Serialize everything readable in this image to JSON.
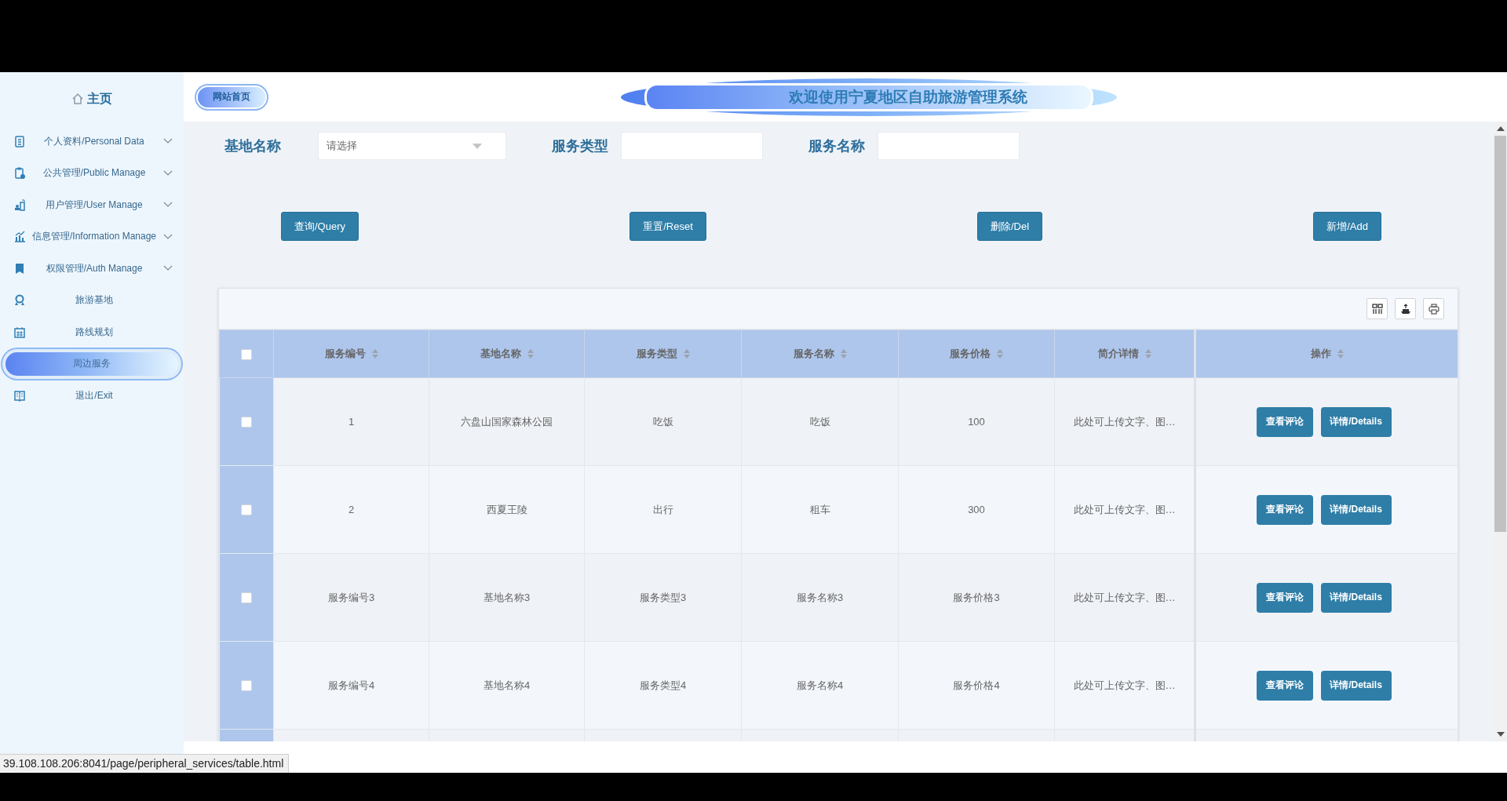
{
  "sidebar": {
    "home": "主页",
    "items": [
      {
        "label": "个人资料/Personal Data",
        "kind": "group",
        "expanded": false,
        "selected": false
      },
      {
        "label": "公共管理/Public Manage",
        "kind": "group",
        "expanded": false,
        "selected": false
      },
      {
        "label": "用户管理/User Manage",
        "kind": "group",
        "expanded": false,
        "selected": false
      },
      {
        "label": "信息管理/Information Manage",
        "kind": "group",
        "expanded": false,
        "selected": false
      },
      {
        "label": "权限管理/Auth Manage",
        "kind": "group",
        "expanded": false,
        "selected": false
      },
      {
        "label": "旅游基地",
        "kind": "link",
        "selected": false
      },
      {
        "label": "路线规划",
        "kind": "link",
        "selected": false
      },
      {
        "label": "周边服务",
        "kind": "link",
        "selected": true
      },
      {
        "label": "退出/Exit",
        "kind": "link",
        "selected": false
      }
    ]
  },
  "header": {
    "home_link": "网站首页",
    "title": "欢迎使用宁夏地区自助旅游管理系统"
  },
  "filters": [
    {
      "label": "基地名称",
      "kind": "select",
      "placeholder": "请选择"
    },
    {
      "label": "服务类型",
      "kind": "text"
    },
    {
      "label": "服务名称",
      "kind": "text"
    }
  ],
  "buttons": [
    "查询/Query",
    "重置/Reset",
    "删除/Del",
    "新增/Add"
  ],
  "table": {
    "select_all": {
      "checked": false
    },
    "columns": [
      {
        "label": "服务编号",
        "sortable": true
      },
      {
        "label": "基地名称",
        "sortable": true
      },
      {
        "label": "服务类型",
        "sortable": true
      },
      {
        "label": "服务名称",
        "sortable": true
      },
      {
        "label": "服务价格",
        "sortable": true
      },
      {
        "label": "简介详情",
        "sortable": true
      }
    ],
    "action_column": {
      "label": "操作",
      "sortable": true
    },
    "rows": [
      {
        "checked": false,
        "cells": [
          "1",
          "六盘山国家森林公园",
          "吃饭",
          "吃饭",
          "100",
          "此处可上传文字、图…"
        ],
        "actions": [
          "查看评论",
          "详情/Details"
        ]
      },
      {
        "checked": false,
        "cells": [
          "2",
          "西夏王陵",
          "出行",
          "租车",
          "300",
          "此处可上传文字、图…"
        ],
        "actions": [
          "查看评论",
          "详情/Details"
        ]
      },
      {
        "checked": false,
        "cells": [
          "服务编号3",
          "基地名称3",
          "服务类型3",
          "服务名称3",
          "服务价格3",
          "此处可上传文字、图…"
        ],
        "actions": [
          "查看评论",
          "详情/Details"
        ]
      },
      {
        "checked": false,
        "cells": [
          "服务编号4",
          "基地名称4",
          "服务类型4",
          "服务名称4",
          "服务价格4",
          "此处可上传文字、图…"
        ],
        "actions": [
          "查看评论",
          "详情/Details"
        ]
      }
    ]
  },
  "browser": {
    "status_url": "39.108.108.206:8041/page/peripheral_services/table.html"
  }
}
